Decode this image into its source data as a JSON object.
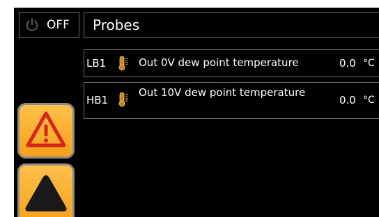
{
  "power": {
    "label": "OFF",
    "icon": "power-icon"
  },
  "header": {
    "title": "Probes"
  },
  "probes": [
    {
      "id": "LB1",
      "icon": "thermometer-icon",
      "description": "Out 0V dew point temperature",
      "value": "0.0",
      "unit": "°C"
    },
    {
      "id": "HB1",
      "icon": "thermometer-icon",
      "description": "Out 10V dew point temperature",
      "value": "0.0",
      "unit": "°C"
    }
  ],
  "side_buttons": [
    {
      "name": "alarm",
      "icon": "warning-icon"
    },
    {
      "name": "up",
      "icon": "triangle-up-icon"
    }
  ],
  "colors": {
    "background": "#000000",
    "border": "#6f6f6f",
    "button_orange": "#f4a11a",
    "warning_red": "#d9241c",
    "thermometer_gold": "#d4a23a"
  }
}
